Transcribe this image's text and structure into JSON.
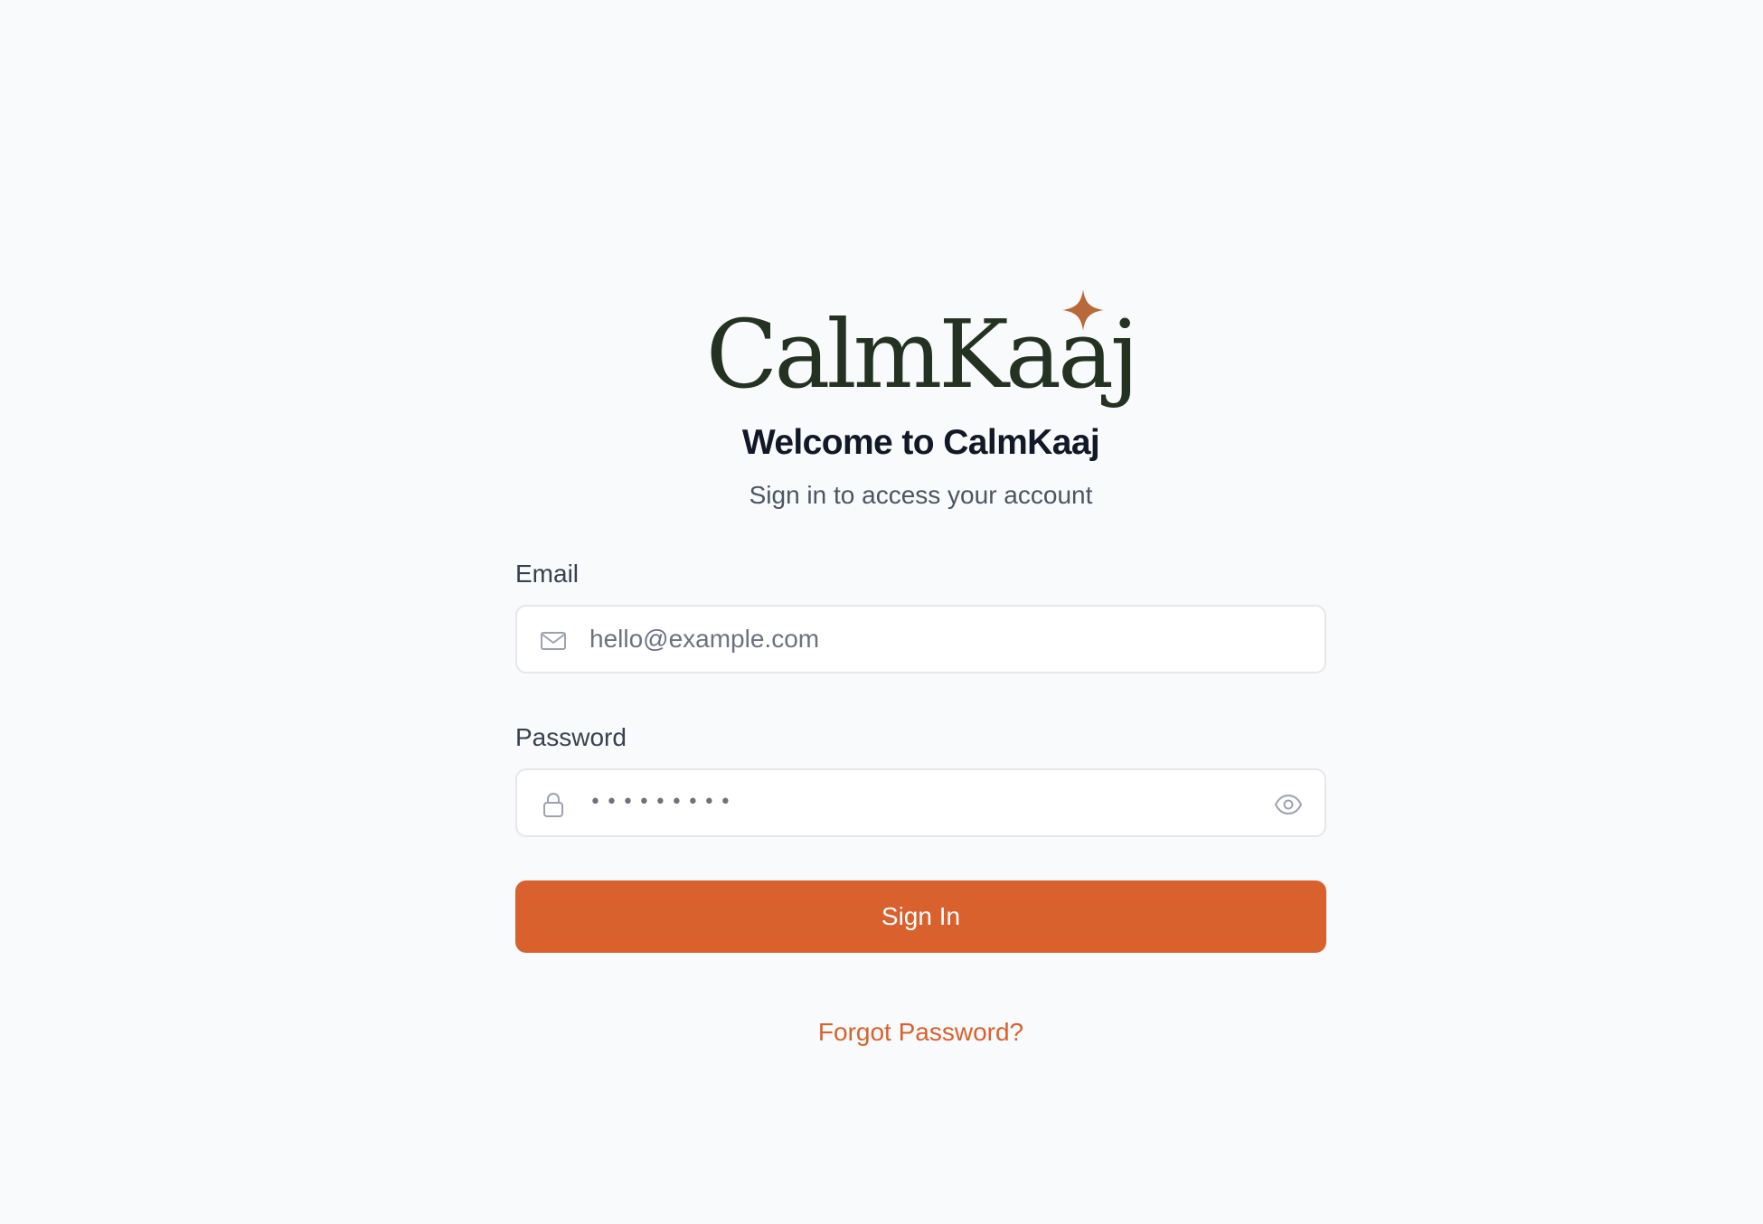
{
  "brand": {
    "logo_text": "CalmKaaj",
    "colors": {
      "logo": "#243221",
      "accent": "#d9612d"
    }
  },
  "header": {
    "title": "Welcome to CalmKaaj",
    "subtitle": "Sign in to access your account"
  },
  "form": {
    "email": {
      "label": "Email",
      "placeholder": "hello@example.com",
      "icon": "mail-icon"
    },
    "password": {
      "label": "Password",
      "value_display": "•••••••••",
      "icon": "lock-icon",
      "toggle_icon": "eye-icon"
    },
    "submit_label": "Sign In",
    "forgot_label": "Forgot Password?"
  }
}
